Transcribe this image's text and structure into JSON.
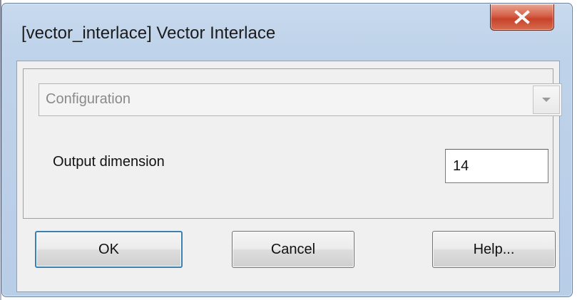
{
  "window": {
    "title": "[vector_interlace] Vector Interlace",
    "close_icon": "close-icon"
  },
  "config": {
    "dropdown_value": "Configuration",
    "dropdown_arrow_icon": "chevron-down-icon"
  },
  "params": {
    "output_dimension_label": "Output dimension",
    "output_dimension_value": "14"
  },
  "buttons": {
    "ok": "OK",
    "cancel": "Cancel",
    "help": "Help..."
  },
  "colors": {
    "frame": "#bfd3ea",
    "close_button": "#c7432a",
    "default_button_border": "#3c7fb1"
  }
}
